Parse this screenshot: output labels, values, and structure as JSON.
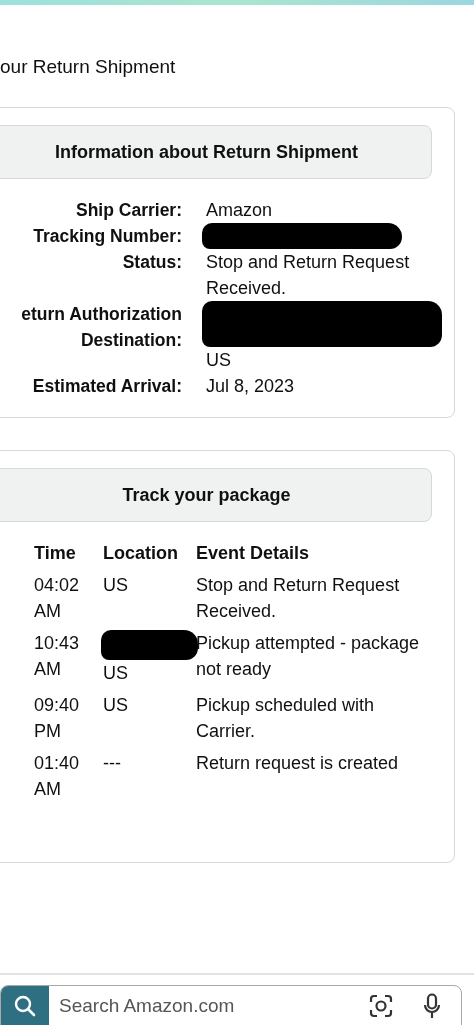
{
  "page_title": "our Return Shipment",
  "shipment_card": {
    "title": "Information about Return Shipment",
    "details": [
      {
        "label": "Ship Carrier:",
        "value": "Amazon"
      },
      {
        "label": "Tracking Number:",
        "redacted": true
      },
      {
        "label": "Status:",
        "value": "Stop and Return Request Received."
      },
      {
        "label": "eturn Authorization Destination:",
        "value": "US",
        "redacted": true
      },
      {
        "label": "Estimated Arrival:",
        "value": "Jul 8, 2023"
      }
    ]
  },
  "tracking_card": {
    "title": "Track your package",
    "columns": [
      "Time",
      "Location",
      "Event Details"
    ],
    "rows": [
      {
        "time": "04:02 AM",
        "location": "US",
        "event": "Stop and Return Request Received."
      },
      {
        "time": "10:43 AM",
        "location": "US",
        "redacted": true,
        "event": "Pickup attempted - package not ready"
      },
      {
        "time": "09:40 PM",
        "location": "US",
        "event": "Pickup scheduled with Carrier."
      },
      {
        "time": "01:40 AM",
        "location": "---",
        "event": "Return request is created"
      }
    ]
  },
  "search_bar": {
    "placeholder": "Search Amazon.com"
  }
}
